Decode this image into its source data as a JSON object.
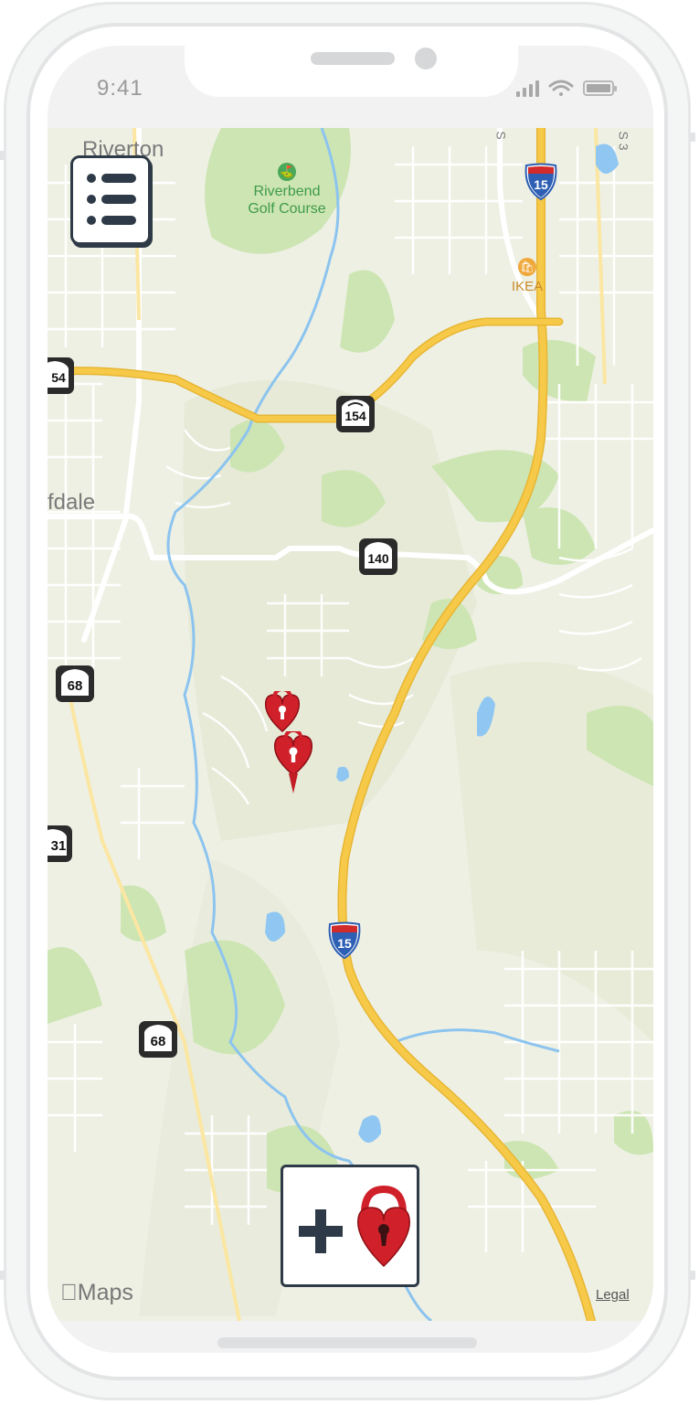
{
  "status_bar": {
    "time": "9:41"
  },
  "map": {
    "place_labels": {
      "riverton": "Riverton",
      "bluffdale": "fdale",
      "golf_line1": "Riverbend",
      "golf_line2": "Golf Course",
      "ikea": "IKEA",
      "street_s": "S",
      "street_s3": "S 3"
    },
    "highway_shields": {
      "i15_top": "15",
      "i15_bottom": "15",
      "sr154_center": "154",
      "sr154_left": "54",
      "sr140": "140",
      "sr68_upper": "68",
      "sr68_lower": "68",
      "sr31": "31"
    },
    "attribution": "Maps",
    "legal": "Legal"
  },
  "colors": {
    "interstate_road": "#f7c948",
    "lock_pin": "#d0202a",
    "button_border": "#2e3a47",
    "park": "#cfe6b5",
    "water": "#8fc7f2"
  },
  "icons": {
    "menu": "list-icon",
    "add": "plus-icon",
    "lock": "heart-lock-icon",
    "pin": "heart-lock-map-pin"
  }
}
